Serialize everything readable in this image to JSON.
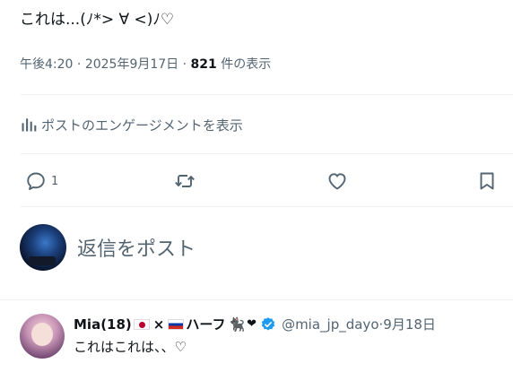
{
  "post": {
    "text": "これは...(ﾉ*> ∀ <)ﾉ♡",
    "time": "午後4:20",
    "sep1": " · ",
    "date": "2025年9月17日",
    "sep2": " · ",
    "views_count": "821",
    "views_label": " 件の表示"
  },
  "engagement": {
    "label": "ポストのエンゲージメントを表示"
  },
  "actions": {
    "reply_count": "1"
  },
  "composer": {
    "placeholder": "返信をポスト"
  },
  "reply": {
    "name": "Mia(18)",
    "times_sign": "×",
    "half_label": "ハーフ",
    "cat": "🐈‍⬛",
    "heart": "❤",
    "handle": "@mia_jp_dayo",
    "sep": " · ",
    "date": "9月18日",
    "text": "これはこれは、、♡"
  },
  "colors": {
    "text": "#0f1419",
    "secondary": "#536471",
    "divider": "#eff3f4",
    "verified": "#1d9bf0"
  },
  "icons": [
    "reply-icon",
    "retweet-icon",
    "like-icon",
    "bookmark-icon",
    "analytics-icon",
    "verified-icon"
  ]
}
